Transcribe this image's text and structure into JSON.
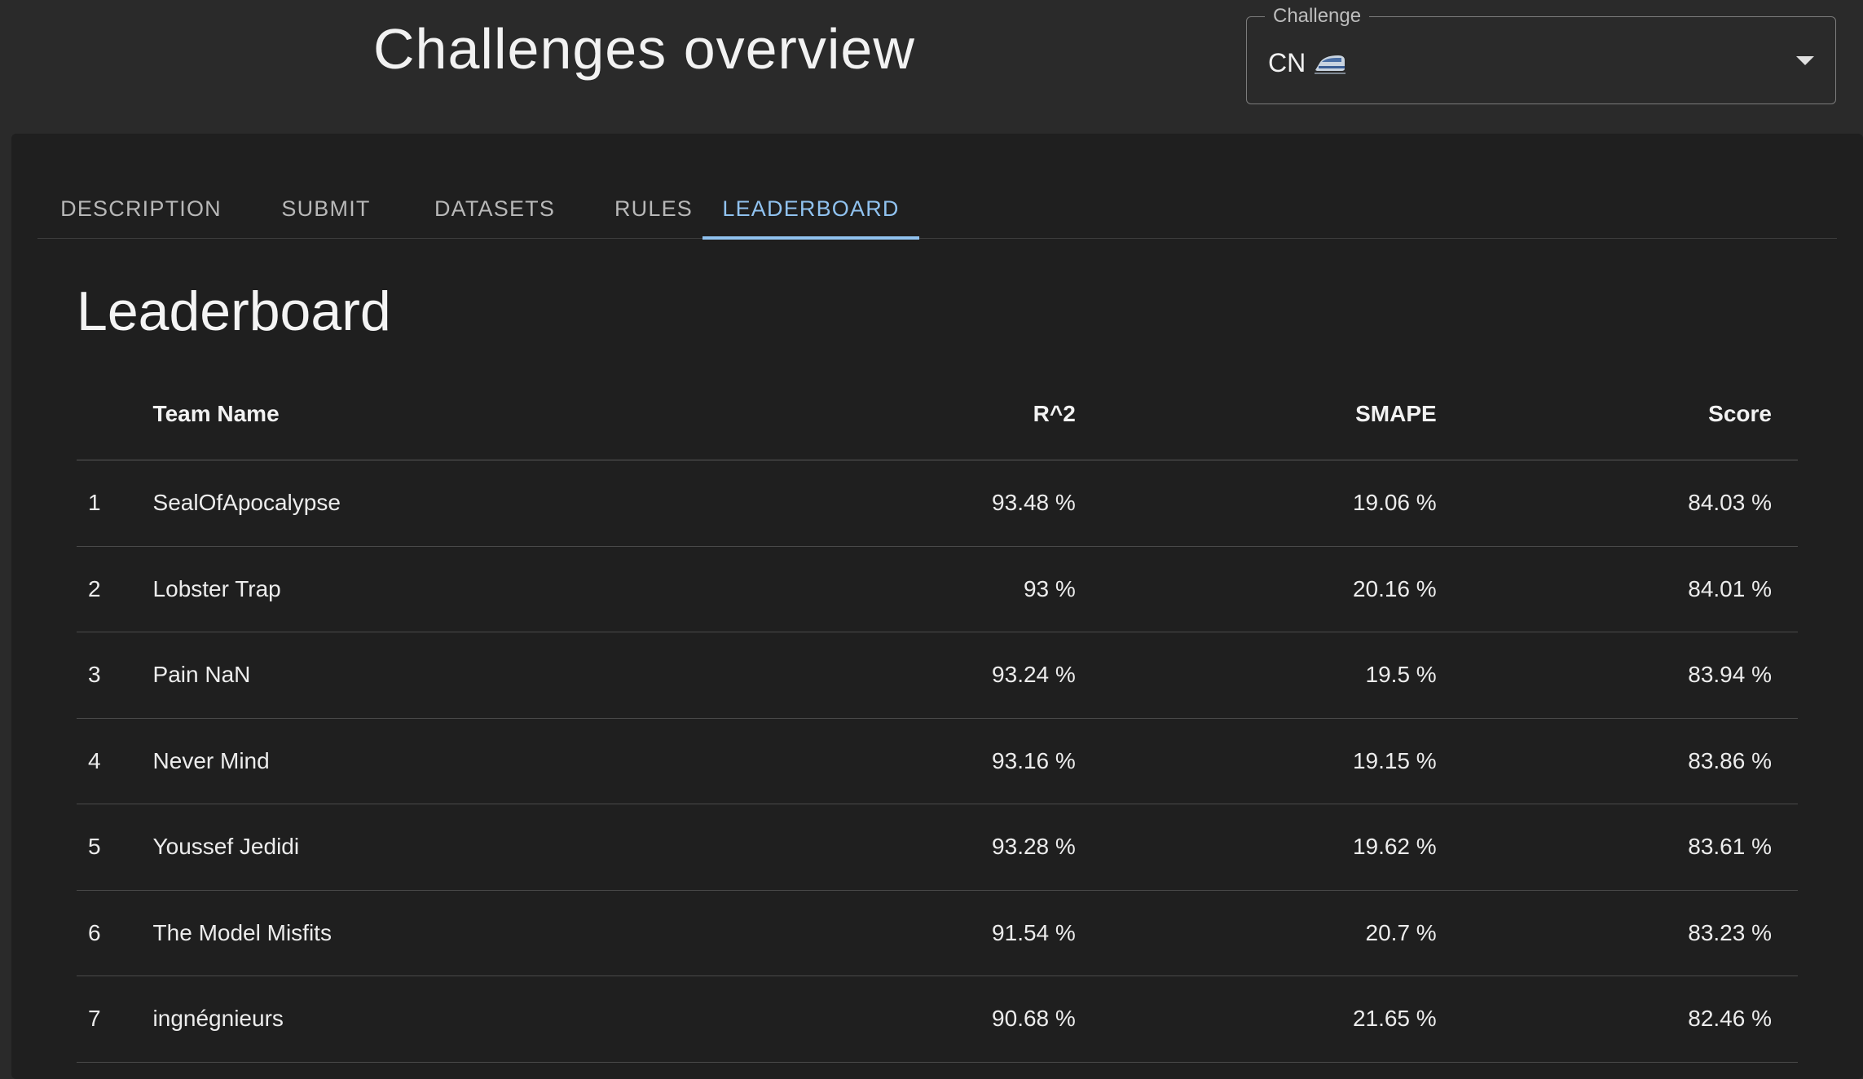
{
  "header": {
    "title": "Challenges overview",
    "challenge_label": "Challenge",
    "challenge_value": "CN"
  },
  "tabs": [
    {
      "label": "DESCRIPTION",
      "active": false
    },
    {
      "label": "SUBMIT",
      "active": false
    },
    {
      "label": "DATASETS",
      "active": false
    },
    {
      "label": "RULES",
      "active": false
    },
    {
      "label": "LEADERBOARD",
      "active": true
    }
  ],
  "leaderboard": {
    "heading": "Leaderboard",
    "columns": [
      "",
      "Team Name",
      "R^2",
      "SMAPE",
      "Score"
    ],
    "rows": [
      {
        "rank": "1",
        "team": "SealOfApocalypse",
        "r2": "93.48 %",
        "smape": "19.06 %",
        "score": "84.03 %"
      },
      {
        "rank": "2",
        "team": "Lobster Trap",
        "r2": "93 %",
        "smape": "20.16 %",
        "score": "84.01 %"
      },
      {
        "rank": "3",
        "team": "Pain NaN",
        "r2": "93.24 %",
        "smape": "19.5 %",
        "score": "83.94 %"
      },
      {
        "rank": "4",
        "team": "Never Mind",
        "r2": "93.16 %",
        "smape": "19.15 %",
        "score": "83.86 %"
      },
      {
        "rank": "5",
        "team": "Youssef Jedidi",
        "r2": "93.28 %",
        "smape": "19.62 %",
        "score": "83.61 %"
      },
      {
        "rank": "6",
        "team": "The Model Misfits",
        "r2": "91.54 %",
        "smape": "20.7 %",
        "score": "83.23 %"
      },
      {
        "rank": "7",
        "team": "ingnégnieurs",
        "r2": "90.68 %",
        "smape": "21.65 %",
        "score": "82.46 %"
      }
    ]
  },
  "colors": {
    "background": "#2a2a2a",
    "panel": "#1f1f1f",
    "accent": "#90c2ef"
  },
  "icons": {
    "challenge_icon": "high-speed-train-icon",
    "select_arrow": "caret-down-icon"
  }
}
